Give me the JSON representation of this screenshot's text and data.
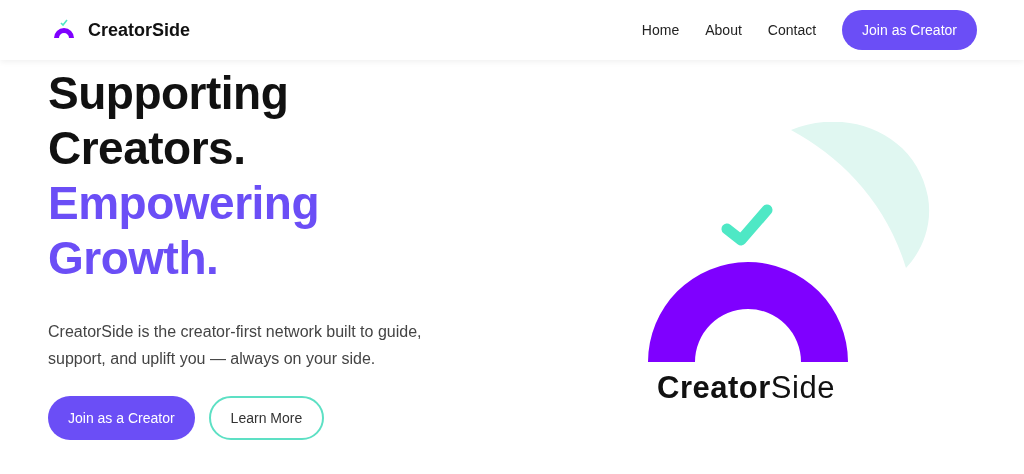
{
  "header": {
    "brand": "CreatorSide",
    "nav": [
      {
        "label": "Home"
      },
      {
        "label": "About"
      },
      {
        "label": "Contact"
      }
    ],
    "cta": "Join as Creator"
  },
  "hero": {
    "heading_lines": [
      {
        "text": "Supporting",
        "accent": false
      },
      {
        "text": "Creators.",
        "accent": false
      },
      {
        "text": "Empowering",
        "accent": true
      },
      {
        "text": "Growth.",
        "accent": true
      }
    ],
    "description": "CreatorSide is the creator-first network built to guide, support, and uplift you — always on your side.",
    "buttons": [
      {
        "label": "Join as a Creator",
        "kind": "primary"
      },
      {
        "label": "Learn More",
        "kind": "outline"
      }
    ]
  },
  "illustration": {
    "wordmark": "**Creator**Side"
  }
}
